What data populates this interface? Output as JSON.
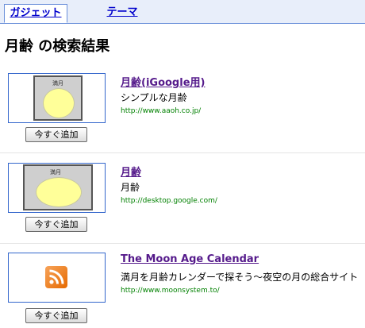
{
  "tabs": [
    {
      "label": "ガジェット",
      "active": true
    },
    {
      "label": "テーマ",
      "active": false
    }
  ],
  "heading": "月齢 の検索結果",
  "results": [
    {
      "title": "月齢(iGoogle用)",
      "description": "シンプルな月齢",
      "url": "http://www.aaoh.co.jp/",
      "add_label": "今すぐ追加",
      "thumb_label": "満月",
      "thumb_icon": "moon-icon"
    },
    {
      "title": "月齢",
      "description": "月齢",
      "url": "http://desktop.google.com/",
      "add_label": "今すぐ追加",
      "thumb_label": "満月",
      "thumb_icon": "moon-icon"
    },
    {
      "title": "The Moon Age Calendar",
      "description": "満月を月齢カレンダーで探そう〜夜空の月の総合サイト",
      "url": "http://www.moonsystem.to/",
      "add_label": "今すぐ追加",
      "thumb_icon": "rss-feed-icon"
    }
  ],
  "colors": {
    "link": "#551a8b",
    "url": "#008000",
    "tab_bg": "#e8eefa",
    "accent": "#3366cc",
    "rss": "#f08a24"
  }
}
